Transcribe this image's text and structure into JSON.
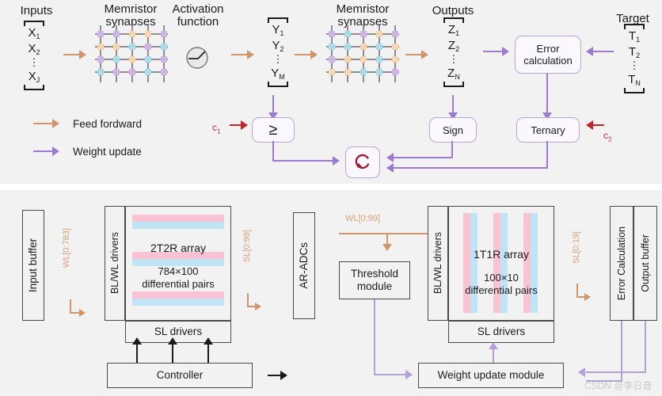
{
  "figure": {
    "title": "Memristor neural network architecture and hardware block diagram",
    "colors": {
      "panel_bg": "#f2f2f2",
      "feed_forward": "#d2956b",
      "weight_update": "#9d7ad1",
      "control_red": "#c0272d",
      "box_border_purple": "#b9a3da",
      "box_border_grey": "#4a4a4a",
      "stripe_pink": "#f9c3d4",
      "stripe_blue": "#bfe4f5"
    }
  },
  "top_panel": {
    "headers": {
      "inputs": "Inputs",
      "memristor_synapses_1": "Memristor\nsynapses",
      "activation_function": "Activation\nfunction",
      "memristor_synapses_2": "Memristor\nsynapses",
      "outputs": "Outputs",
      "target": "Target"
    },
    "header_inputs": "Inputs",
    "header_syn1_l1": "Memristor",
    "header_syn1_l2": "synapses",
    "header_act_l1": "Activation",
    "header_act_l2": "function",
    "header_syn2_l1": "Memristor",
    "header_syn2_l2": "synapses",
    "header_outputs": "Outputs",
    "header_target": "Target",
    "vectors": {
      "input": {
        "name": "X",
        "items": [
          "X",
          "X",
          "X"
        ],
        "subs": [
          "1",
          "2",
          "J"
        ],
        "dots": "⋮"
      },
      "hidden": {
        "name": "Y",
        "items": [
          "Y",
          "Y",
          "Y"
        ],
        "subs": [
          "1",
          "2",
          "M"
        ],
        "dots": "⋮"
      },
      "output": {
        "name": "Z",
        "items": [
          "Z",
          "Z",
          "Z"
        ],
        "subs": [
          "1",
          "2",
          "N"
        ],
        "dots": "⋮"
      },
      "target": {
        "name": "T",
        "items": [
          "T",
          "T",
          "T"
        ],
        "subs": [
          "1",
          "2",
          "N"
        ],
        "dots": "⋮"
      }
    },
    "x1": "X",
    "x1s": "1",
    "x2": "X",
    "x2s": "2",
    "x3": "X",
    "x3s": "J",
    "y1": "Y",
    "y1s": "1",
    "y2": "Y",
    "y2s": "2",
    "y3": "Y",
    "y3s": "M",
    "z1": "Z",
    "z1s": "1",
    "z2": "Z",
    "z2s": "2",
    "z3": "Z",
    "z3s": "N",
    "t1": "T",
    "t1s": "1",
    "t2": "T",
    "t2s": "2",
    "t3": "T",
    "t3s": "N",
    "vdots": "⋮",
    "boxes": {
      "error_calculation_l1": "Error",
      "error_calculation_l2": "calculation",
      "threshold_symbol": "≥",
      "sign": "Sign",
      "ternary": "Ternary",
      "loop_icon": "refresh-loop-icon"
    },
    "constants": {
      "c1": "c",
      "c1_sub": "1",
      "c2": "c",
      "c2_sub": "2"
    },
    "legend": [
      {
        "label": "Feed fordward",
        "color": "#d2956b",
        "name": "feed-forward"
      },
      {
        "label": "Weight update",
        "color": "#9d7ad1",
        "name": "weight-update"
      }
    ],
    "legend_feed": "Feed fordward",
    "legend_weight": "Weight update",
    "activation_icon": "sigmoid-curve-icon"
  },
  "bottom_panel": {
    "input_buffer": "Input buffer",
    "bl_wl_drivers_1": "BL/WL drivers",
    "bl_wl_drivers_2": "BL/WL drivers",
    "sl_drivers_1": "SL drivers",
    "sl_drivers_2": "SL drivers",
    "array1_title": "2T2R array",
    "array1_sub_l1": "784×100",
    "array1_sub_l2": "differential pairs",
    "array2_title": "1T1R array",
    "array2_sub_l1": "100×10",
    "array2_sub_l2": "differential pairs",
    "ar_adcs": "AR-ADCs",
    "threshold_module_l1": "Threshold",
    "threshold_module_l2": "module",
    "error_calculation": "Error Calculation",
    "output_buffer": "Output buffer",
    "controller": "Controller",
    "weight_update_module": "Weight update module",
    "bus_labels": {
      "wl_783": "WL[0:783]",
      "sl_99": "SL[0:99]",
      "wl_99": "WL[0:99]",
      "sl_19": "SL[0:19]"
    },
    "wl783": "WL[0:783]",
    "sl99": "SL[0:99]",
    "wl99": "WL[0:99]",
    "sl19": "SL[0:19]"
  },
  "watermark": "CSDN @李日音"
}
